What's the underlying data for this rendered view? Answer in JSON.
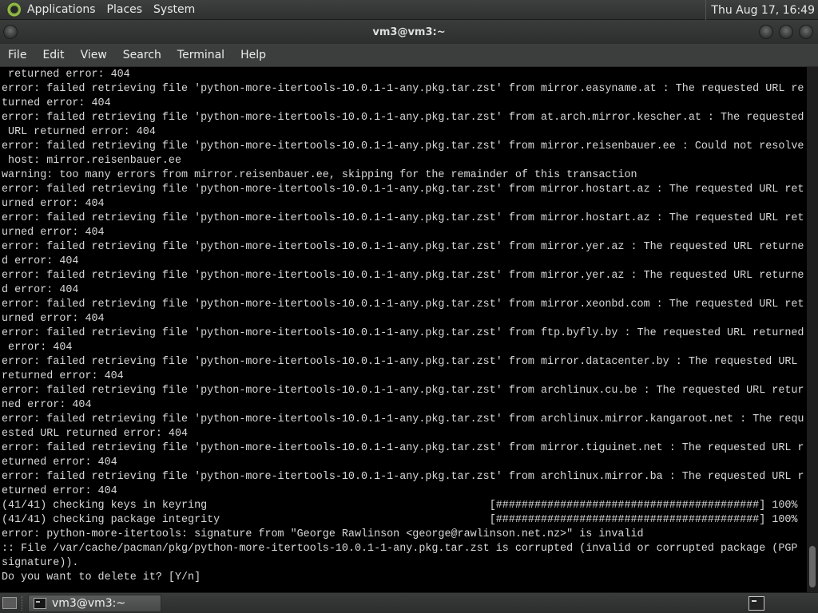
{
  "top_panel": {
    "menus": [
      "Applications",
      "Places",
      "System"
    ],
    "clock": "Thu Aug 17, 16:49"
  },
  "window": {
    "title": "vm3@vm3:~"
  },
  "menu_bar": {
    "items": [
      "File",
      "Edit",
      "View",
      "Search",
      "Terminal",
      "Help"
    ]
  },
  "terminal": {
    "lines": [
      " returned error: 404",
      "error: failed retrieving file 'python-more-itertools-10.0.1-1-any.pkg.tar.zst' from mirror.easyname.at : The requested URL re",
      "turned error: 404",
      "error: failed retrieving file 'python-more-itertools-10.0.1-1-any.pkg.tar.zst' from at.arch.mirror.kescher.at : The requested",
      " URL returned error: 404",
      "error: failed retrieving file 'python-more-itertools-10.0.1-1-any.pkg.tar.zst' from mirror.reisenbauer.ee : Could not resolve",
      " host: mirror.reisenbauer.ee",
      "warning: too many errors from mirror.reisenbauer.ee, skipping for the remainder of this transaction",
      "error: failed retrieving file 'python-more-itertools-10.0.1-1-any.pkg.tar.zst' from mirror.hostart.az : The requested URL ret",
      "urned error: 404",
      "error: failed retrieving file 'python-more-itertools-10.0.1-1-any.pkg.tar.zst' from mirror.hostart.az : The requested URL ret",
      "urned error: 404",
      "error: failed retrieving file 'python-more-itertools-10.0.1-1-any.pkg.tar.zst' from mirror.yer.az : The requested URL returne",
      "d error: 404",
      "error: failed retrieving file 'python-more-itertools-10.0.1-1-any.pkg.tar.zst' from mirror.yer.az : The requested URL returne",
      "d error: 404",
      "error: failed retrieving file 'python-more-itertools-10.0.1-1-any.pkg.tar.zst' from mirror.xeonbd.com : The requested URL ret",
      "urned error: 404",
      "error: failed retrieving file 'python-more-itertools-10.0.1-1-any.pkg.tar.zst' from ftp.byfly.by : The requested URL returned",
      " error: 404",
      "error: failed retrieving file 'python-more-itertools-10.0.1-1-any.pkg.tar.zst' from mirror.datacenter.by : The requested URL",
      "returned error: 404",
      "error: failed retrieving file 'python-more-itertools-10.0.1-1-any.pkg.tar.zst' from archlinux.cu.be : The requested URL retur",
      "ned error: 404",
      "error: failed retrieving file 'python-more-itertools-10.0.1-1-any.pkg.tar.zst' from archlinux.mirror.kangaroot.net : The requ",
      "ested URL returned error: 404",
      "error: failed retrieving file 'python-more-itertools-10.0.1-1-any.pkg.tar.zst' from mirror.tiguinet.net : The requested URL r",
      "eturned error: 404",
      "error: failed retrieving file 'python-more-itertools-10.0.1-1-any.pkg.tar.zst' from archlinux.mirror.ba : The requested URL r",
      "eturned error: 404",
      "(41/41) checking keys in keyring                                            [#########################################] 100%",
      "(41/41) checking package integrity                                          [#########################################] 100%",
      "error: python-more-itertools: signature from \"George Rawlinson <george@rawlinson.net.nz>\" is invalid",
      ":: File /var/cache/pacman/pkg/python-more-itertools-10.0.1-1-any.pkg.tar.zst is corrupted (invalid or corrupted package (PGP",
      "signature)).",
      "Do you want to delete it? [Y/n]"
    ]
  },
  "taskbar": {
    "task_label": "vm3@vm3:~"
  },
  "icons": {
    "panel_logo": "distro-logo-icon",
    "task_icon": "terminal-icon",
    "workspace": "workspace-switcher-icon",
    "show_desktop": "show-desktop-icon"
  },
  "colors": {
    "panel_bg": "#333434",
    "terminal_bg": "#000000",
    "terminal_fg": "#d8d8d8"
  }
}
